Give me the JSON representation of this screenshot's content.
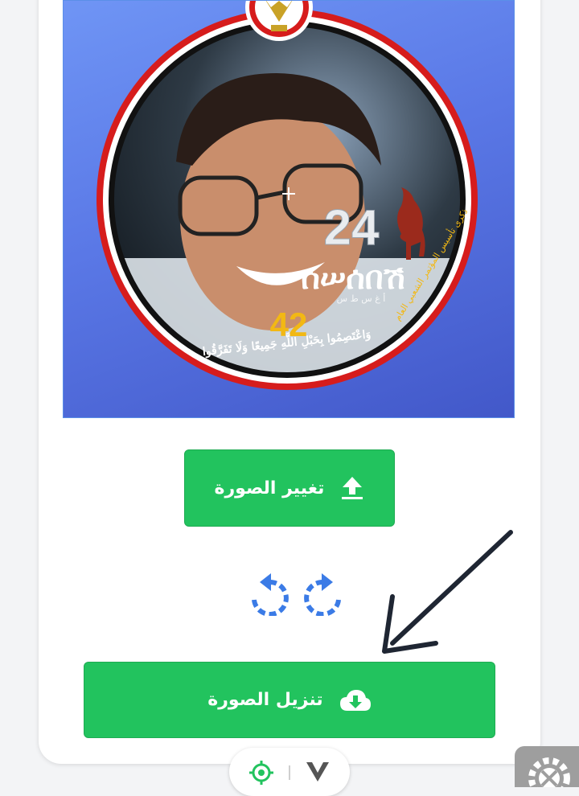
{
  "frame": {
    "number_big": "24",
    "number_small": "42",
    "himyarite_text": "ሰሠሰበሽ",
    "himyarite_transliteration": "أ غ س ط س",
    "verse": "وَاعْتَصِمُوا بِحَبْلِ اللَّهِ جَمِيعًا وَلَا تَفَرَّقُوا",
    "side_text": "ذكرى تأسيس المؤتمر الشعبي العام",
    "colors": {
      "flag_red": "#d61c1c",
      "flag_black": "#111111",
      "gold": "#f2b814",
      "background": "#5a78e6"
    }
  },
  "actions": {
    "change_photo_label": "تغيير الصورة",
    "download_photo_label": "تنزيل الصورة"
  },
  "icons": {
    "change_photo": "upload-icon",
    "rotate_left": "rotate-left-icon",
    "rotate_right": "rotate-right-icon",
    "download": "cloud-download-icon",
    "pointer": "arrow-pointer",
    "bottom_left": "crosshair-icon",
    "bottom_right": "chevron-down-icon",
    "corner": "gear-tools-icon"
  },
  "accent_color": "#22c35e",
  "icon_color": "#3b7be6"
}
